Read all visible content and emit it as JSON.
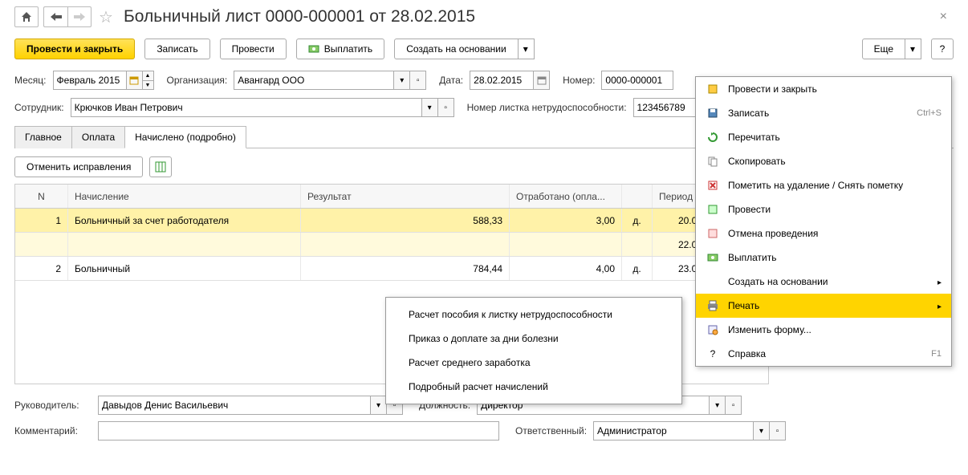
{
  "header": {
    "title": "Больничный лист 0000-000001 от 28.02.2015"
  },
  "toolbar": {
    "post_close": "Провести и закрыть",
    "save": "Записать",
    "post": "Провести",
    "pay": "Выплатить",
    "create_based": "Создать на основании",
    "more": "Еще",
    "help": "?"
  },
  "form": {
    "month_label": "Месяц:",
    "month_value": "Февраль 2015",
    "org_label": "Организация:",
    "org_value": "Авангард ООО",
    "date_label": "Дата:",
    "date_value": "28.02.2015",
    "number_label": "Номер:",
    "number_value": "0000-000001",
    "employee_label": "Сотрудник:",
    "employee_value": "Крючков Иван Петрович",
    "sicklist_num_label": "Номер листка нетрудоспособности:",
    "sicklist_num_value": "123456789"
  },
  "tabs": {
    "main": "Главное",
    "pay": "Оплата",
    "accrued": "Начислено (подробно)"
  },
  "subtoolbar": {
    "undo": "Отменить исправления"
  },
  "table": {
    "headers": {
      "n": "N",
      "name": "Начисление",
      "result": "Результат",
      "worked": "Отработано (опла...",
      "period": "Период"
    },
    "rows": [
      {
        "n": "1",
        "name": "Больничный за счет работодателя",
        "result": "588,33",
        "worked": "3,00",
        "unit": "д.",
        "period": "20.02.2015",
        "class": "yellow1"
      },
      {
        "n": "",
        "name": "",
        "result": "",
        "worked": "",
        "unit": "",
        "period": "22.02.2015",
        "class": "yellow2"
      },
      {
        "n": "2",
        "name": "Больничный",
        "result": "784,44",
        "worked": "4,00",
        "unit": "д.",
        "period": "23.02.2015",
        "class": ""
      }
    ]
  },
  "footer": {
    "head_label": "Руководитель:",
    "head_value": "Давыдов Денис Васильевич",
    "position_label": "Должность:",
    "position_value": "Директор",
    "comment_label": "Комментарий:",
    "comment_value": "",
    "responsible_label": "Ответственный:",
    "responsible_value": "Администратор"
  },
  "menu": {
    "items": [
      {
        "ico": "post",
        "txt": "Провести и закрыть",
        "shortcut": ""
      },
      {
        "ico": "save",
        "txt": "Записать",
        "shortcut": "Ctrl+S"
      },
      {
        "ico": "reread",
        "txt": "Перечитать",
        "shortcut": ""
      },
      {
        "ico": "copy",
        "txt": "Скопировать",
        "shortcut": ""
      },
      {
        "ico": "del",
        "txt": "Пометить на удаление / Снять пометку",
        "shortcut": ""
      },
      {
        "ico": "post2",
        "txt": "Провести",
        "shortcut": ""
      },
      {
        "ico": "unpost",
        "txt": "Отмена проведения",
        "shortcut": ""
      },
      {
        "ico": "pay",
        "txt": "Выплатить",
        "shortcut": ""
      },
      {
        "ico": "",
        "txt": "Создать на основании",
        "shortcut": "",
        "sub": true
      },
      {
        "ico": "print",
        "txt": "Печать",
        "shortcut": "",
        "sub": true,
        "highlight": true
      },
      {
        "ico": "form",
        "txt": "Изменить форму...",
        "shortcut": ""
      },
      {
        "ico": "help",
        "txt": "Справка",
        "shortcut": "F1"
      }
    ]
  },
  "submenu": {
    "items": [
      "Расчет пособия к листку нетрудоспособности",
      "Приказ о доплате за дни болезни",
      "Расчет среднего заработка",
      "Подробный расчет начислений"
    ]
  }
}
